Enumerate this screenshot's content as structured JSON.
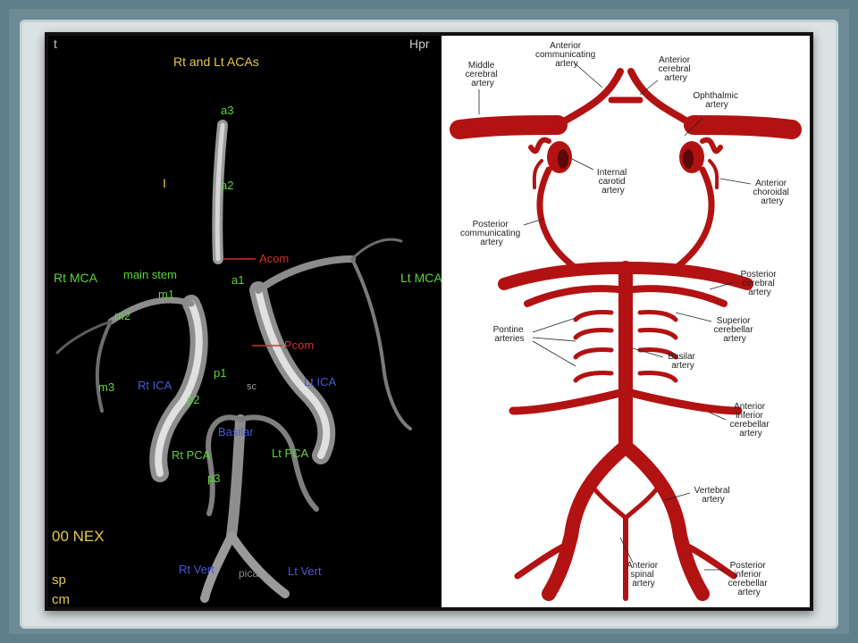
{
  "mra": {
    "corner_left": "t",
    "corner_right": "Hpr",
    "marker": "I",
    "nex": "00 NEX",
    "sp": "sp",
    "cm": "cm",
    "acas": "Rt and Lt ACAs",
    "a3": "a3",
    "a2": "a2",
    "a1": "a1",
    "acom": "Acom",
    "pcom": "Pcom",
    "rt_mca": "Rt MCA",
    "lt_mca": "Lt MCA",
    "main_stem": "main stem",
    "m1": "m1",
    "m2": "m2",
    "m3": "m3",
    "rt_ica": "Rt ICA",
    "lt_ica": "Lt ICA",
    "p1": "p1",
    "p2": "p2",
    "p3": "p3",
    "sc": "sc",
    "basilar": "Basilar",
    "rt_pca": "Rt PCA",
    "lt_pca": "Lt PCA",
    "rt_vert": "Rt Vert",
    "lt_vert": "Lt Vert",
    "pica": "pica"
  },
  "diagram": {
    "acom": [
      "Anterior",
      "communicating",
      "artery"
    ],
    "aca": [
      "Anterior",
      "cerebral",
      "artery"
    ],
    "mca": [
      "Middle",
      "cerebral",
      "artery"
    ],
    "ophthalmic": [
      "Ophthalmic",
      "artery"
    ],
    "ica": [
      "Internal",
      "carotid",
      "artery"
    ],
    "choroidal": [
      "Anterior",
      "choroidal",
      "artery"
    ],
    "pcom": [
      "Posterior",
      "communicating",
      "artery"
    ],
    "pca": [
      "Posterior",
      "cerebral",
      "artery"
    ],
    "sca": [
      "Superior",
      "cerebellar",
      "artery"
    ],
    "pontine": [
      "Pontine",
      "arteries"
    ],
    "basilar": [
      "Basilar",
      "artery"
    ],
    "aica": [
      "Anterior",
      "inferior",
      "cerebellar",
      "artery"
    ],
    "vertebral": [
      "Vertebral",
      "artery"
    ],
    "spinal": [
      "Anterior",
      "spinal",
      "artery"
    ],
    "pica": [
      "Posterior",
      "inferior",
      "cerebellar",
      "artery"
    ]
  },
  "colors": {
    "artery": "#b31212",
    "label_green": "#5fd43a",
    "label_blue": "#4a58d8",
    "label_red": "#d0322a"
  }
}
